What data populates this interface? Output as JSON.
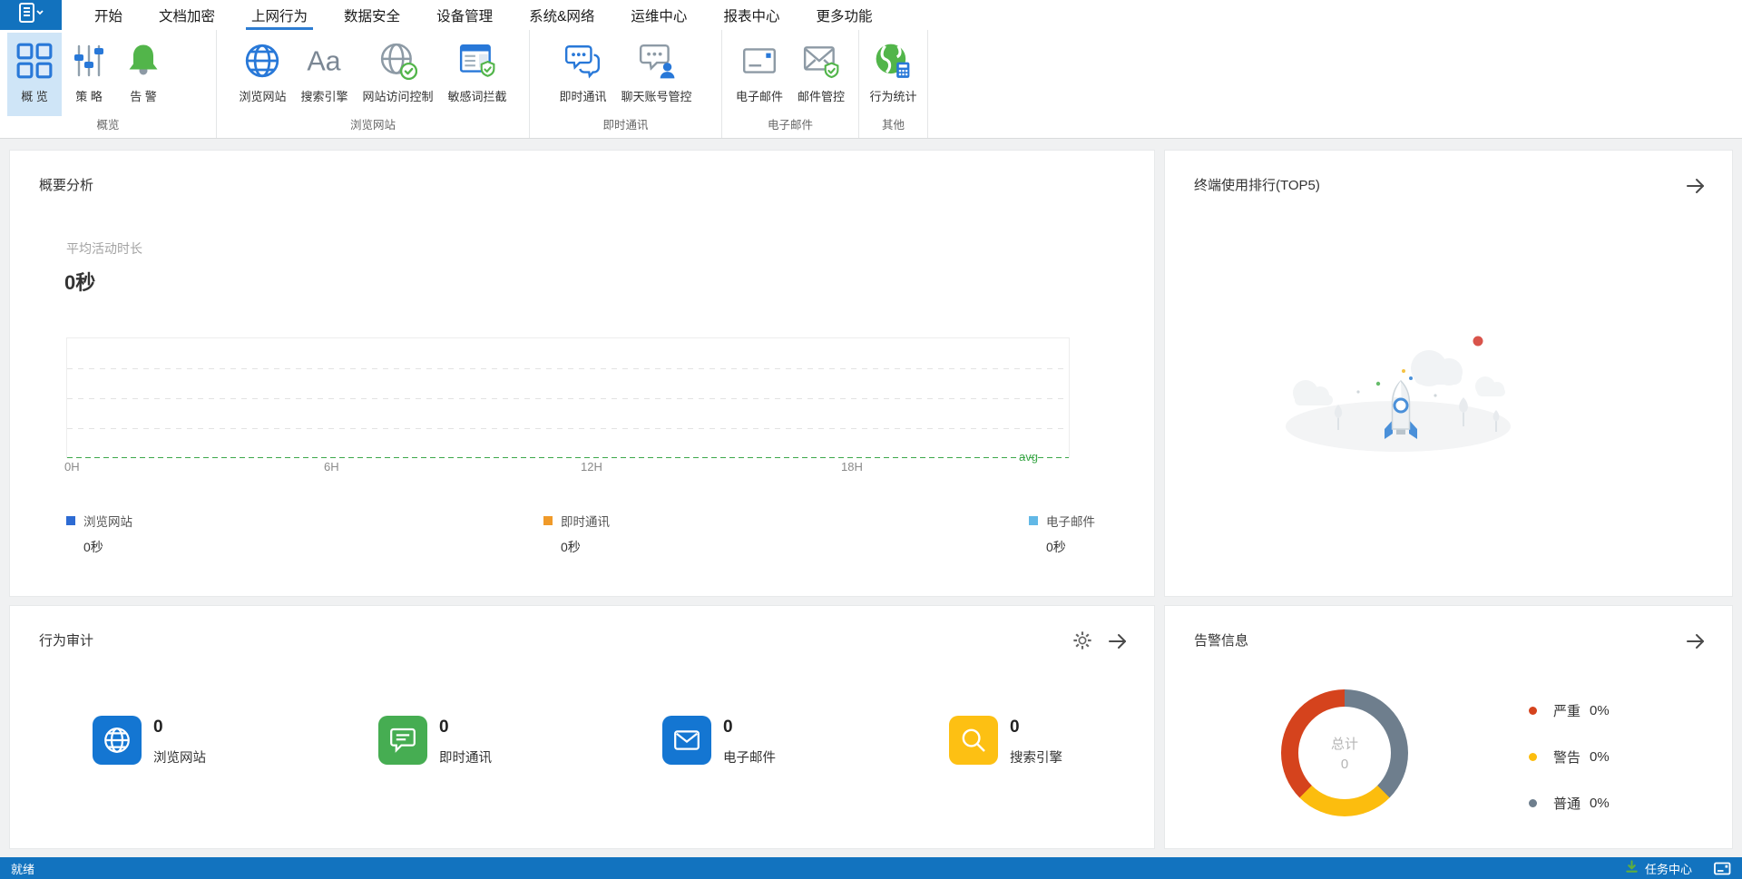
{
  "tabs": {
    "items": [
      "开始",
      "文档加密",
      "上网行为",
      "数据安全",
      "设备管理",
      "系统&网络",
      "运维中心",
      "报表中心",
      "更多功能"
    ],
    "active": "上网行为"
  },
  "ribbon": {
    "groups": [
      {
        "label": "概览",
        "items": [
          {
            "label": "概 览",
            "icon": "grid-icon",
            "selected": true
          },
          {
            "label": "策 略",
            "icon": "sliders-icon"
          },
          {
            "label": "告 警",
            "icon": "bell-icon"
          }
        ]
      },
      {
        "label": "浏览网站",
        "items": [
          {
            "label": "浏览网站",
            "icon": "globe-icon"
          },
          {
            "label": "搜索引擎",
            "icon": "font-icon"
          },
          {
            "label": "网站访问控制",
            "icon": "globe-check-icon"
          },
          {
            "label": "敏感词拦截",
            "icon": "doc-shield-icon"
          }
        ]
      },
      {
        "label": "即时通讯",
        "items": [
          {
            "label": "即时通讯",
            "icon": "chat-icon"
          },
          {
            "label": "聊天账号管控",
            "icon": "chat-user-icon"
          }
        ]
      },
      {
        "label": "电子邮件",
        "items": [
          {
            "label": "电子邮件",
            "icon": "mail-icon"
          },
          {
            "label": "邮件管控",
            "icon": "mail-shield-icon"
          }
        ]
      },
      {
        "label": "其他",
        "items": [
          {
            "label": "行为统计",
            "icon": "globe-calc-icon"
          }
        ]
      }
    ]
  },
  "summary_panel": {
    "title": "概要分析",
    "metric_label": "平均活动时长",
    "metric_value": "0秒",
    "avg_label": "avg",
    "x_ticks": [
      "0H",
      "6H",
      "12H",
      "18H"
    ],
    "legend": [
      {
        "label": "浏览网站",
        "value": "0秒",
        "color": "#2d6bd3"
      },
      {
        "label": "即时通讯",
        "value": "0秒",
        "color": "#f09a29"
      },
      {
        "label": "电子邮件",
        "value": "0秒",
        "color": "#62b8e6"
      }
    ]
  },
  "top5_panel": {
    "title": "终端使用排行(TOP5)"
  },
  "audit_panel": {
    "title": "行为审计",
    "stats": [
      {
        "value": "0",
        "label": "浏览网站",
        "icon": "globe-icon",
        "color": "#1476d2"
      },
      {
        "value": "0",
        "label": "即时通讯",
        "icon": "chat-icon",
        "color": "#46ad52"
      },
      {
        "value": "0",
        "label": "电子邮件",
        "icon": "mail-icon",
        "color": "#1476d2"
      },
      {
        "value": "0",
        "label": "搜索引擎",
        "icon": "search-icon",
        "color": "#fdc013"
      }
    ]
  },
  "alarm_panel": {
    "title": "告警信息",
    "center_label": "总计",
    "center_value": "0",
    "legend": [
      {
        "label": "严重",
        "value": "0%",
        "color": "#d5431d"
      },
      {
        "label": "警告",
        "value": "0%",
        "color": "#fcbd0e"
      },
      {
        "label": "普通",
        "value": "0%",
        "color": "#6e7e8d"
      }
    ]
  },
  "statusbar": {
    "left_text": "就绪",
    "task_center": "任务中心"
  },
  "colors": {
    "accent_blue": "#1272be",
    "tab_underline": "#2d7dd2",
    "ribbon_selected_bg": "#cfe5f7",
    "avg_line_green": "#3da84a",
    "statusbar_blue": "#1273bf"
  },
  "chart_data": [
    {
      "type": "line",
      "title": "平均活动时长",
      "current_value": "0秒",
      "x": [
        0,
        6,
        12,
        18,
        24
      ],
      "x_tick_labels": [
        "0H",
        "6H",
        "12H",
        "18H"
      ],
      "series": [
        {
          "name": "浏览网站",
          "color": "#2d6bd3",
          "values": [
            0,
            0,
            0,
            0,
            0
          ],
          "total": "0秒"
        },
        {
          "name": "即时通讯",
          "color": "#f09a29",
          "values": [
            0,
            0,
            0,
            0,
            0
          ],
          "total": "0秒"
        },
        {
          "name": "电子邮件",
          "color": "#62b8e6",
          "values": [
            0,
            0,
            0,
            0,
            0
          ],
          "total": "0秒"
        }
      ],
      "avg_line": {
        "label": "avg",
        "value": 0,
        "color": "#3da84a",
        "style": "dashed"
      },
      "grid": "horizontal-dashed",
      "legend_position": "bottom"
    },
    {
      "type": "pie",
      "title": "告警信息",
      "donut": true,
      "center_label": "总计",
      "center_value": 0,
      "slices": [
        {
          "name": "严重",
          "value": 0,
          "pct_label": "0%",
          "color": "#d5431d"
        },
        {
          "name": "警告",
          "value": 0,
          "pct_label": "0%",
          "color": "#fcbd0e"
        },
        {
          "name": "普通",
          "value": 0,
          "pct_label": "0%",
          "color": "#6e7e8d"
        }
      ],
      "display_angles_deg": {
        "普通": [
          0,
          135
        ],
        "警告": [
          135,
          225
        ],
        "严重": [
          225,
          360
        ]
      },
      "legend_position": "right"
    }
  ]
}
